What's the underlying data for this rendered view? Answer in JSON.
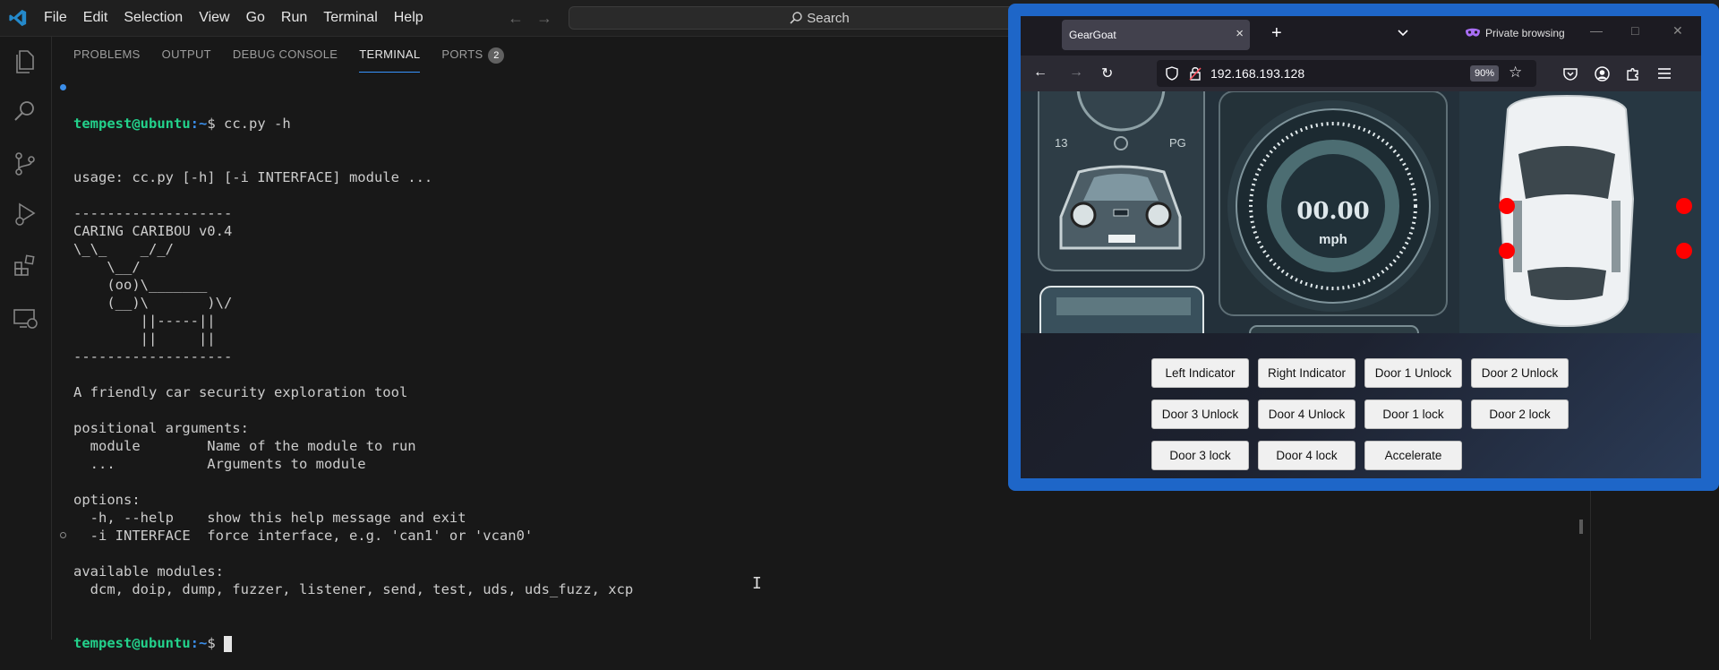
{
  "menu": [
    "File",
    "Edit",
    "Selection",
    "View",
    "Go",
    "Run",
    "Terminal",
    "Help"
  ],
  "search": {
    "label": "Search"
  },
  "activity_icons": [
    "explorer-icon",
    "search-icon",
    "source-control-icon",
    "run-debug-icon",
    "extensions-icon",
    "remote-explorer-icon"
  ],
  "panel": {
    "tabs": [
      "PROBLEMS",
      "OUTPUT",
      "DEBUG CONSOLE",
      "TERMINAL",
      "PORTS"
    ],
    "active_tab": "TERMINAL",
    "ports_badge": "2"
  },
  "terminal": {
    "prompt_user": "tempest@ubuntu",
    "prompt_path": ":~",
    "command": "$ cc.py -h",
    "lines": [
      "usage: cc.py [-h] [-i INTERFACE] module ...",
      "",
      "-------------------",
      "CARING CARIBOU v0.4",
      "\\_\\_    _/_/",
      "    \\__/",
      "    (oo)\\_______",
      "    (__)\\       )\\/",
      "        ||-----||",
      "        ||     ||",
      "-------------------",
      "",
      "A friendly car security exploration tool",
      "",
      "positional arguments:",
      "  module        Name of the module to run",
      "  ...           Arguments to module",
      "",
      "options:",
      "  -h, --help    show this help message and exit",
      "  -i INTERFACE  force interface, e.g. 'can1' or 'vcan0'",
      "",
      "available modules:",
      "  dcm, doip, dump, fuzzer, listener, send, test, uds, uds_fuzz, xcp"
    ],
    "final_prompt_suffix": "$ "
  },
  "browser": {
    "tab_title": "GearGoat",
    "private_label": "Private browsing",
    "url": "192.168.193.128",
    "zoom": "90%",
    "speed": "00.00",
    "speed_unit": "mph",
    "dash_left_letters": [
      "13",
      "PG"
    ],
    "buttons": [
      "Left Indicator",
      "Right Indicator",
      "Door 1 Unlock",
      "Door 2 Unlock",
      "Door 3 Unlock",
      "Door 4 Unlock",
      "Door 1 lock",
      "Door 2 lock",
      "Door 3 lock",
      "Door 4 lock",
      "Accelerate"
    ]
  },
  "colors": {
    "accent": "#3794ff",
    "prompt_user": "#23d18b",
    "prompt_path": "#3b8eea",
    "firefox_frame": "#1e66c8",
    "indicator_dot": "#ff0000"
  }
}
